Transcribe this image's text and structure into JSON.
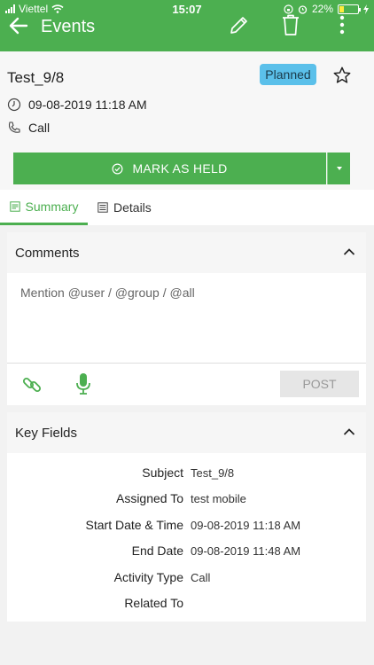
{
  "status_bar": {
    "carrier": "Viettel",
    "time": "15:07",
    "battery": "22%"
  },
  "app_bar": {
    "title": "Events"
  },
  "event": {
    "title": "Test_9/8",
    "status": "Planned",
    "datetime": "09-08-2019 11:18 AM",
    "type": "Call"
  },
  "actions": {
    "mark_held_label": "MARK AS HELD"
  },
  "tabs": [
    {
      "label": "Summary"
    },
    {
      "label": "Details"
    }
  ],
  "comments": {
    "title": "Comments",
    "placeholder": "Mention @user / @group / @all",
    "post_label": "POST"
  },
  "key_fields": {
    "title": "Key Fields",
    "rows": [
      {
        "label": "Subject",
        "value": "Test_9/8"
      },
      {
        "label": "Assigned To",
        "value": "test mobile"
      },
      {
        "label": "Start Date & Time",
        "value": "09-08-2019 11:18 AM"
      },
      {
        "label": "End Date",
        "value": "09-08-2019 11:48 AM"
      },
      {
        "label": "Activity Type",
        "value": "Call"
      },
      {
        "label": "Related To",
        "value": ""
      }
    ]
  },
  "colors": {
    "accent": "#4caf50",
    "badge": "#5bc0ea"
  }
}
